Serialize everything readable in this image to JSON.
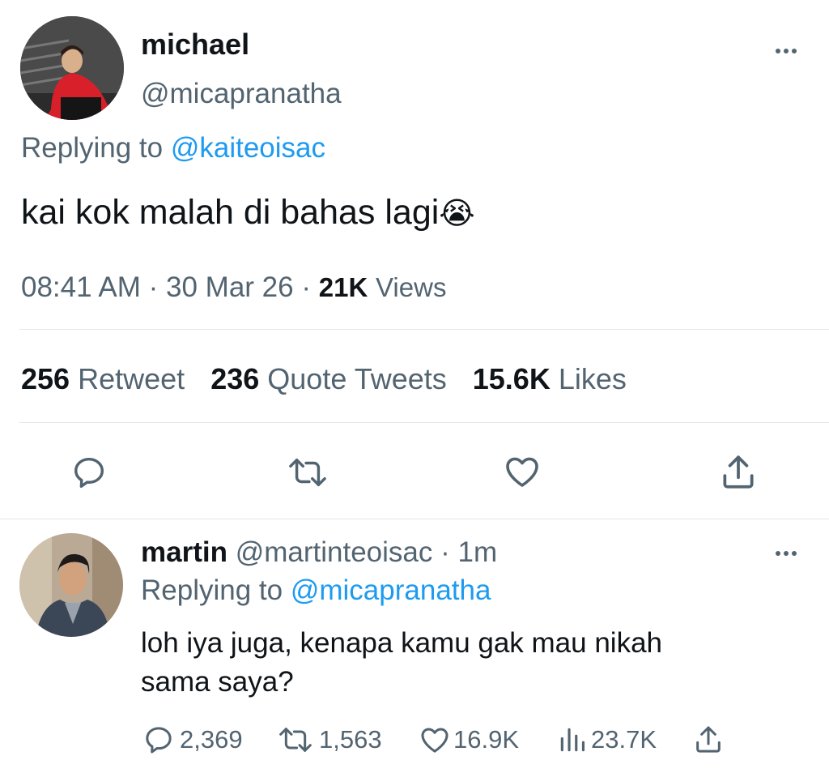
{
  "main_tweet": {
    "display_name": "michael",
    "handle": "@micapranatha",
    "replying_label": "Replying to",
    "replying_to": "@kaiteoisac",
    "text": "kai kok malah di bahas lagi",
    "emoji": "😭",
    "time": "08:41 AM",
    "date": "30 Mar 26",
    "separator": "·",
    "views_count": "21K",
    "views_label": "Views",
    "retweets_count": "256",
    "retweets_label": "Retweet",
    "quotes_count": "236",
    "quotes_label": "Quote Tweets",
    "likes_count": "15.6K",
    "likes_label": "Likes"
  },
  "reply_tweet": {
    "display_name": "martin",
    "handle": "@martinteoisac",
    "age": "· 1m",
    "replying_label": "Replying to",
    "replying_to": "@micapranatha",
    "text_line1": "loh iya juga, kenapa kamu gak mau nikah",
    "text_line2": "sama saya?",
    "replies": "2,369",
    "retweets": "1,563",
    "likes": "16.9K",
    "views": "23.7K"
  },
  "icons": [
    "more-icon",
    "reply-icon",
    "retweet-icon",
    "like-icon",
    "share-icon",
    "views-icon"
  ],
  "colors": {
    "accent": "#1d9bf0",
    "secondary_text": "#536471",
    "divider": "#e1e8ed"
  }
}
